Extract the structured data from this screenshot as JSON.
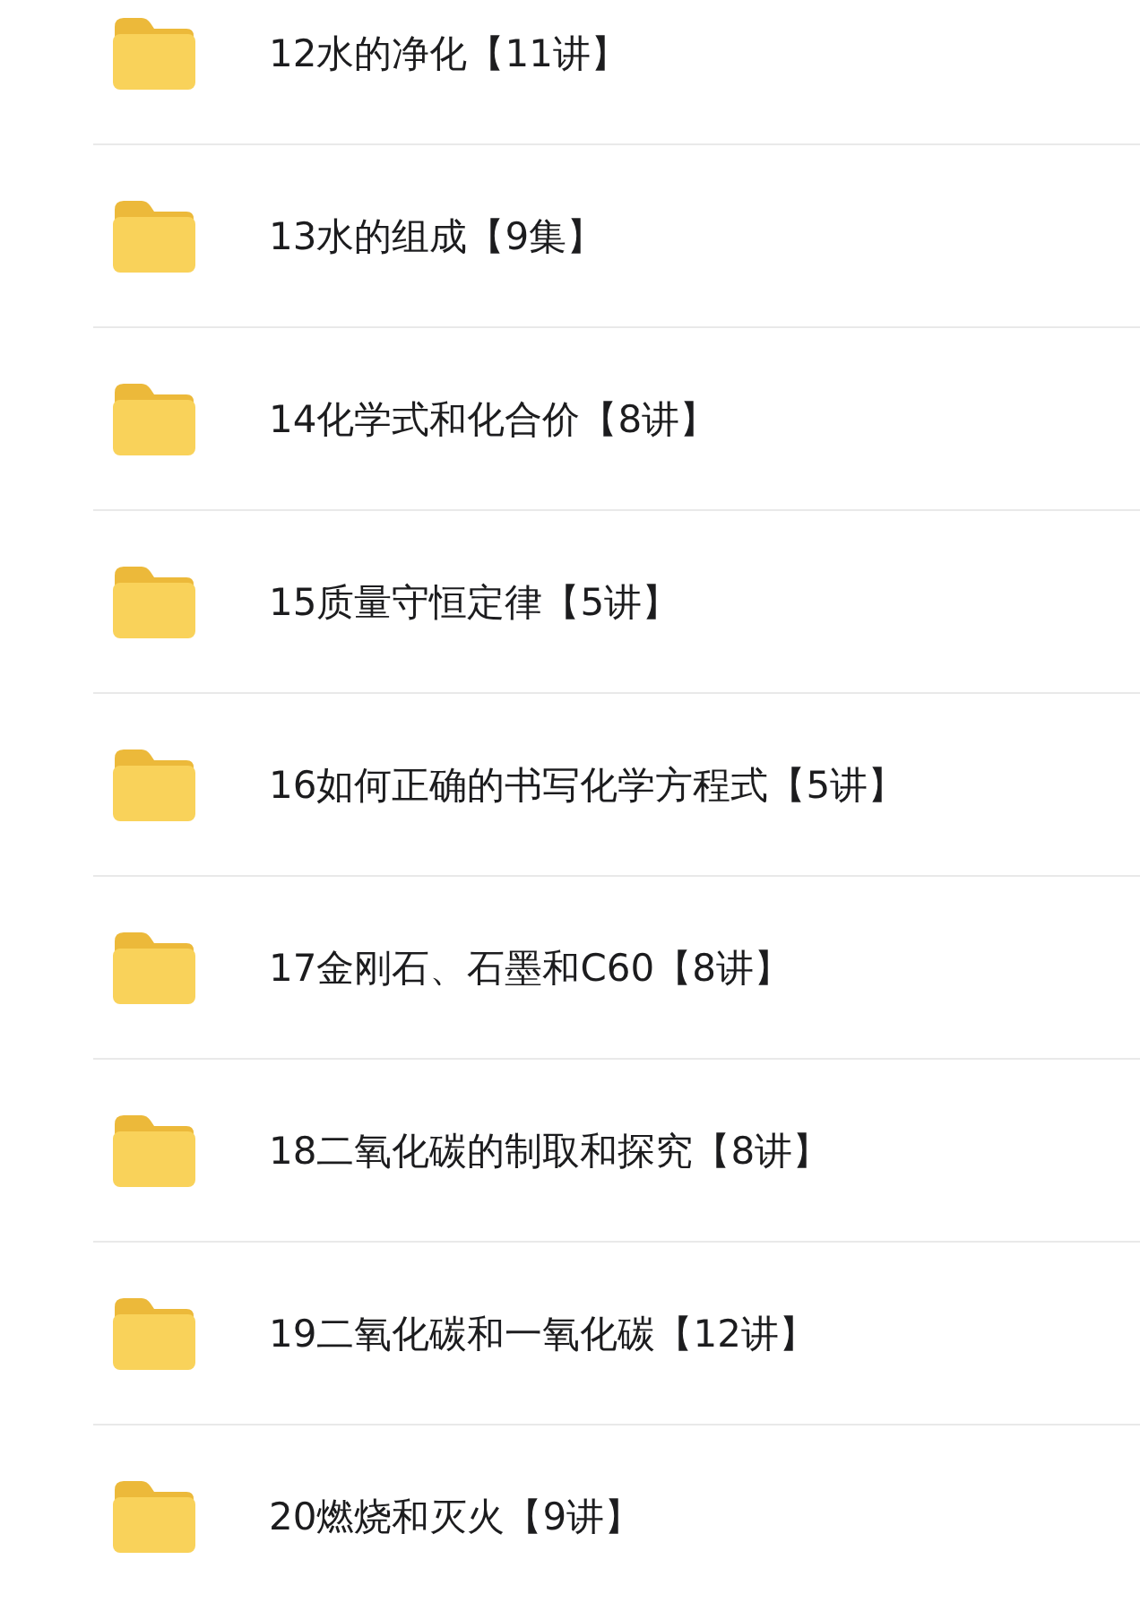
{
  "folders": [
    {
      "name": "12水的净化【11讲】"
    },
    {
      "name": "13水的组成【9集】"
    },
    {
      "name": "14化学式和化合价【8讲】"
    },
    {
      "name": "15质量守恒定律【5讲】"
    },
    {
      "name": "16如何正确的书写化学方程式【5讲】"
    },
    {
      "name": "17金刚石、石墨和C60【8讲】"
    },
    {
      "name": "18二氧化碳的制取和探究【8讲】"
    },
    {
      "name": "19二氧化碳和一氧化碳【12讲】"
    },
    {
      "name": "20燃烧和灭火【9讲】"
    }
  ]
}
